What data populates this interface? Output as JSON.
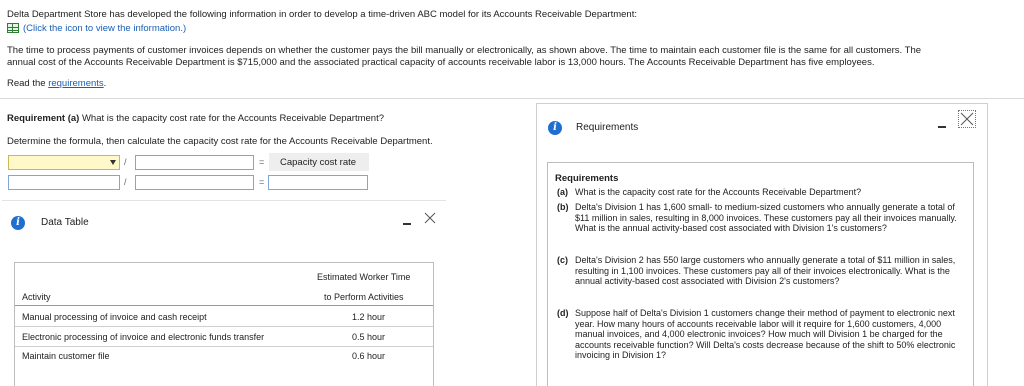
{
  "intro": {
    "line1": "Delta Department Store has developed the following information in order to develop a time-driven ABC model for its Accounts Receivable Department:",
    "click_link": "(Click the icon to view the information.)",
    "para_line1": "The time to process payments of customer invoices depends on whether the customer pays the bill manually or electronically, as shown above. The time to maintain each customer file is the same for all customers. The",
    "para_line2": "annual cost of the Accounts Receivable Department is $715,000 and the associated practical capacity of accounts receivable labor is 13,000 hours. The Accounts Receivable Department has five employees.",
    "read_prefix": "Read the ",
    "read_link": "requirements",
    "read_suffix": "."
  },
  "question": {
    "req_label": "Requirement (a)",
    "req_text": " What is the capacity cost rate for the Accounts Receivable Department?",
    "instruction": "Determine the formula, then calculate the capacity cost rate for the Accounts Receivable Department.",
    "row1": {
      "select_value": "",
      "divide": "/",
      "equals": "=",
      "result_label": "Capacity cost rate"
    },
    "row2": {
      "divide": "/",
      "equals": "="
    }
  },
  "data_table_panel": {
    "title": "Data Table",
    "header_line1": "Estimated Worker Time",
    "header_line2": "to Perform Activities",
    "col_activity": "Activity",
    "rows": [
      {
        "activity": "Manual processing of invoice and cash receipt",
        "time": "1.2 hour"
      },
      {
        "activity": "Electronic processing of invoice and electronic funds transfer",
        "time": "0.5 hour"
      },
      {
        "activity": "Maintain customer file",
        "time": "0.6 hour"
      }
    ]
  },
  "requirements_panel": {
    "title": "Requirements",
    "heading": "Requirements",
    "items": [
      {
        "tag": "(a)",
        "text": "What is the capacity cost rate for the Accounts Receivable Department?"
      },
      {
        "tag": "(b)",
        "text": "Delta's Division 1 has 1,600 small- to medium-sized customers who annually generate a total of $11 million in sales, resulting in 8,000 invoices. These customers pay all their invoices manually. What is the annual activity-based cost associated with Division 1's customers?"
      },
      {
        "tag": "(c)",
        "text": "Delta's Division 2 has 550 large customers who annually generate a total of $11 million in sales, resulting in 1,100 invoices. These customers pay all of their invoices electronically. What is the annual activity-based cost associated with Division 2's customers?"
      },
      {
        "tag": "(d)",
        "text": "Suppose half of Delta's Division 1 customers change their method of payment to electronic next year. How many hours of accounts receivable labor will it require for 1,600 customers, 4,000 manual invoices, and 4,000 electronic invoices? How much will Division 1 be charged for the accounts receivable function? Will Delta's costs decrease because of the shift to 50% electronic invoicing in Division 1?"
      }
    ]
  },
  "colors": {
    "link": "#1a5fb4",
    "info_icon": "#1f6fd1",
    "input_border": "#7fa6d6",
    "select_bg": "#fff8c8"
  }
}
